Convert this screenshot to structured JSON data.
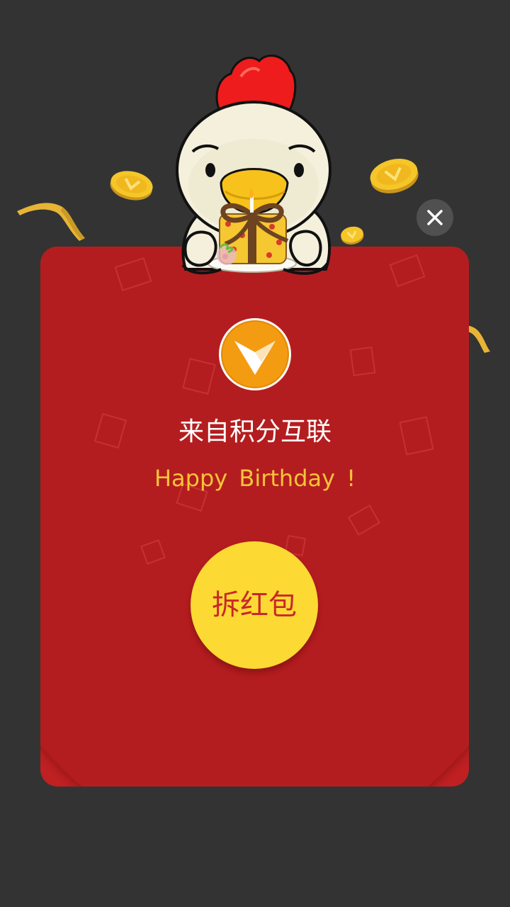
{
  "red_packet": {
    "sender": "来自积分互联",
    "greeting": "Happy  Birthday !",
    "open_button_label": "拆红包"
  },
  "icons": {
    "close": "close-icon",
    "logo": "v-logo-icon",
    "mascot": "chick-mascot-with-cake"
  },
  "colors": {
    "background": "#333333",
    "envelope": "#bf2022",
    "flap": "#b41d1f",
    "greeting_text": "#f6c339",
    "open_button": "#fcd933",
    "open_button_text": "#c8282a",
    "logo_orange": "#f39c12"
  }
}
